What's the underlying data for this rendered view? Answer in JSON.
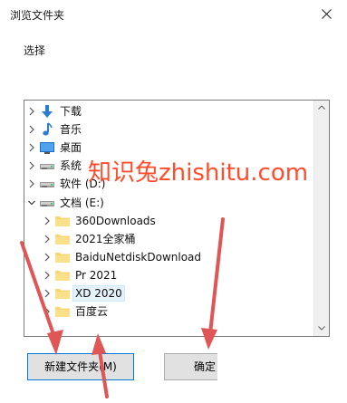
{
  "dialog": {
    "title": "浏览文件夹",
    "prompt": "选择"
  },
  "tree": {
    "items": [
      {
        "label": "下载",
        "icon": "download-arrow-icon",
        "expanded": false,
        "level": 1
      },
      {
        "label": "音乐",
        "icon": "music-note-icon",
        "expanded": false,
        "level": 1
      },
      {
        "label": "桌面",
        "icon": "desktop-icon",
        "expanded": false,
        "level": 1
      },
      {
        "label": "系统",
        "icon": "drive-icon",
        "expanded": false,
        "level": 1
      },
      {
        "label": "软件 (D:)",
        "icon": "drive-icon",
        "expanded": false,
        "level": 1
      },
      {
        "label": "文档 (E:)",
        "icon": "drive-icon",
        "expanded": true,
        "level": 1
      },
      {
        "label": "360Downloads",
        "icon": "folder-icon",
        "expanded": false,
        "level": 2
      },
      {
        "label": "2021全家桶",
        "icon": "folder-icon",
        "expanded": false,
        "level": 2
      },
      {
        "label": "BaiduNetdiskDownload",
        "icon": "folder-icon",
        "expanded": false,
        "level": 2
      },
      {
        "label": "Pr 2021",
        "icon": "folder-icon",
        "expanded": false,
        "level": 2
      },
      {
        "label": "XD 2020",
        "icon": "folder-icon",
        "expanded": false,
        "level": 2,
        "selected": true
      },
      {
        "label": "百度云",
        "icon": "folder-icon",
        "expanded": false,
        "level": 2
      }
    ]
  },
  "watermark": "知识兔zhishitu.com",
  "buttons": {
    "new_folder": "新建文件夹(M)",
    "ok": "确定"
  },
  "colors": {
    "folder": "#f8d775",
    "selection": "#e5f1fb",
    "accent_border": "#0078d7",
    "annotation_arrow": "#e05555",
    "watermark": "#ff4c2c"
  }
}
